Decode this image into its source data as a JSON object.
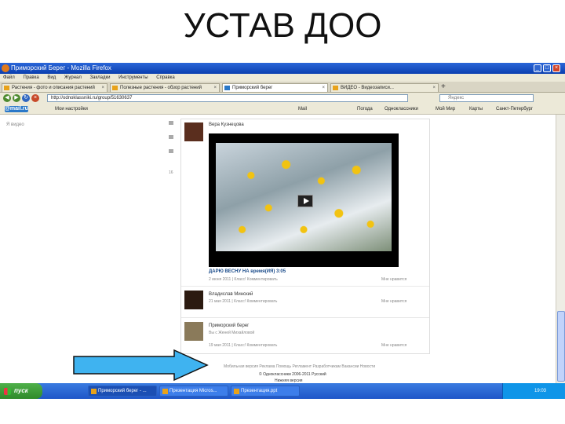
{
  "slide": {
    "title": "УСТАВ ДОО"
  },
  "window": {
    "title": "Приморский Берег - Mozilla Firefox"
  },
  "menu": [
    "Файл",
    "Правка",
    "Вид",
    "Журнал",
    "Закладки",
    "Инструменты",
    "Справка"
  ],
  "tabs": [
    {
      "label": "Растения - фото и описания растений"
    },
    {
      "label": "Полезные растения - обзор растений"
    },
    {
      "label": "Приморский берег"
    },
    {
      "label": "ВИДЕО - Видеозаписи..."
    }
  ],
  "nav": {
    "url": "http://odnoklassniki.ru/group/51630637",
    "search_placeholder": "Яндекс"
  },
  "bookmarks": {
    "logo": "@mail.ru",
    "items": [
      "Мои настройки",
      "Mail",
      "Погода",
      "Одноклассники",
      "Мой Мир",
      "Карты",
      "Санкт-Петербург"
    ]
  },
  "page": {
    "left_meta": "Я видео",
    "posts": [
      {
        "author": "Вера Кузнецова",
        "caption": "ДАРЮ ВЕСНУ НА время(ИЯ) 3:05",
        "meta": "2 июня 2011 | Класс! Комментировать",
        "meta_right": "Мне нравится"
      },
      {
        "author": "Владислав Минский",
        "meta": "21 мая 2011 | Класс! Комментировать",
        "meta_right": "Мне нравится"
      },
      {
        "author": "Приморский берег",
        "subtitle": "Вы с Женей Михайловой",
        "meta": "19 мая 2011 | Класс! Комментировать",
        "meta_right": "Мне нравится"
      }
    ],
    "side_counts": [
      "16"
    ],
    "footer_links": "Мобильная версия  Реклама  Помощь  Регламент  Разработчикам  Вакансии  Новости",
    "footer_copy": "© Одноклассники 2006-2011 Русский",
    "footer_version": "Нижняя версия"
  },
  "taskbar": {
    "start": "пуск",
    "items": [
      "Приморский берег - ...",
      "Презентация Micros...",
      "Презентация.ppt"
    ],
    "clock": "19:03"
  },
  "colors": {
    "titlebar": "#0a3fb0",
    "arrow": "#3fb3f0",
    "arrow_stroke": "#111111",
    "taskbar": "#1f56c8"
  }
}
